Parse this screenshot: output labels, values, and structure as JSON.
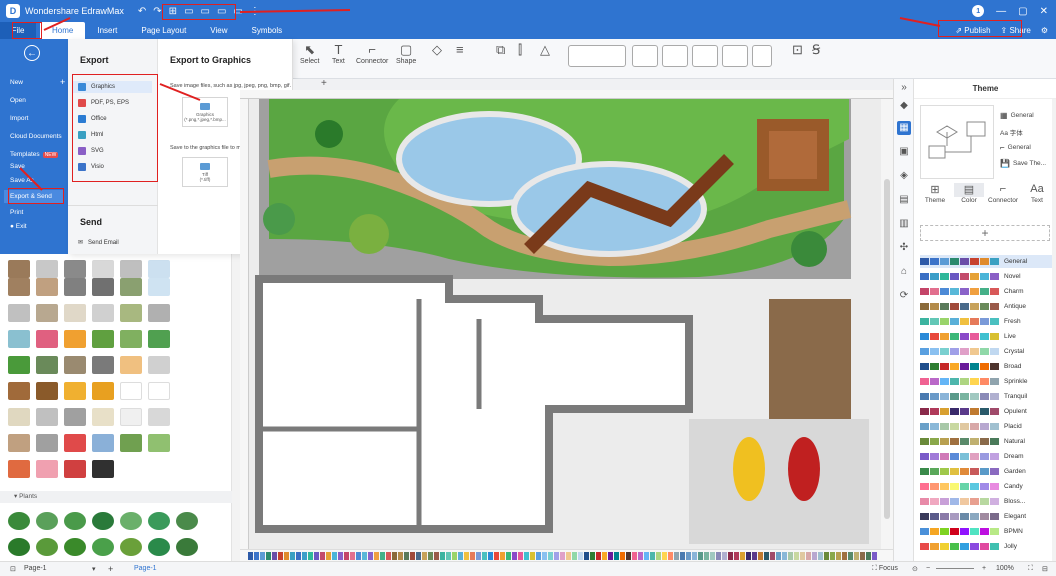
{
  "app": {
    "name": "Wondershare EdrawMax",
    "logo": "D"
  },
  "menu": {
    "file": "File",
    "home": "Home",
    "insert": "Insert",
    "page_layout": "Page Layout",
    "view": "View",
    "symbols": "Symbols"
  },
  "top_right": {
    "publish": "Publish",
    "share": "Share",
    "badge": "1"
  },
  "ribbon": {
    "select": "Select",
    "text": "Text",
    "connector": "Connector",
    "shape": "Shape"
  },
  "file_menu": {
    "items": [
      "New",
      "Open",
      "Import",
      "Cloud Documents",
      "Templates",
      "Save",
      "Save As",
      "Export & Send",
      "Print",
      "Exit"
    ],
    "new_badge": "NEW"
  },
  "export": {
    "heading": "Export",
    "heading_graphics": "Export to Graphics",
    "send_heading": "Send",
    "formats": [
      "Graphics",
      "PDF, PS, EPS",
      "Office",
      "Html",
      "SVG",
      "Visio"
    ],
    "send_email": "Send Email",
    "desc1": "Save image files, such as jpg, jpeg, png, bmp, gif.",
    "card1_label": "Graphics",
    "card1_sub": "(*.png,*.jpeg,*.bmp...",
    "desc2": "Save to the graphics file to multiple page tiff file.",
    "card2_label": "Tiff",
    "card2_sub": "(*.tiff)"
  },
  "library": {
    "plants_header": "Plants"
  },
  "tabs": {
    "page1": "Page-1",
    "add": "+"
  },
  "status": {
    "page_label": "Page-1",
    "focus": "Focus",
    "zoom": "100%"
  },
  "theme": {
    "title": "Theme",
    "options": [
      "General",
      "Aa 字体",
      "General",
      "Save The..."
    ],
    "tabs": [
      "Theme",
      "Color",
      "Connector",
      "Text"
    ],
    "add": "+",
    "palettes": [
      {
        "name": "General",
        "colors": [
          "#2d5aa8",
          "#3b73c9",
          "#5b9bd5",
          "#2b8a6e",
          "#6a4ea8",
          "#c7422e",
          "#e08b2c",
          "#3aa0c2"
        ]
      },
      {
        "name": "Novel",
        "colors": [
          "#3a6fc4",
          "#3b9ec9",
          "#2fb89a",
          "#6a58c2",
          "#c34b6b",
          "#e6a135",
          "#4bb5d8",
          "#8a5fc6"
        ]
      },
      {
        "name": "Charm",
        "colors": [
          "#c44468",
          "#e26f8e",
          "#4d8ad6",
          "#58b8d8",
          "#8a63c9",
          "#f0a040",
          "#45b088",
          "#d85858"
        ]
      },
      {
        "name": "Antique",
        "colors": [
          "#8a6a3a",
          "#b38b4a",
          "#5a7a5a",
          "#a04a3a",
          "#4a6a8a",
          "#c7a25a",
          "#6a8a5a",
          "#9a5a4a"
        ]
      },
      {
        "name": "Fresh",
        "colors": [
          "#3cb4a0",
          "#62c7b6",
          "#9ad46a",
          "#5ab0d8",
          "#f0c040",
          "#e67a5a",
          "#7a9ad8",
          "#4ac0c0"
        ]
      },
      {
        "name": "Live",
        "colors": [
          "#2a8ad8",
          "#e8483c",
          "#f0a030",
          "#3cb878",
          "#8a4ac8",
          "#e85a9a",
          "#40c0d0",
          "#d8c030"
        ]
      },
      {
        "name": "Crystal",
        "colors": [
          "#5aa0e0",
          "#8ac0f0",
          "#7ad0d0",
          "#a0a0e8",
          "#e0a0c8",
          "#f0c890",
          "#90d8a8",
          "#c0d8f0"
        ]
      },
      {
        "name": "Broad",
        "colors": [
          "#1f4e8c",
          "#2e7d32",
          "#c62828",
          "#f9a825",
          "#6a1b9a",
          "#00838f",
          "#ef6c00",
          "#4e342e"
        ]
      },
      {
        "name": "Sprinkle",
        "colors": [
          "#f06292",
          "#ba68c8",
          "#64b5f6",
          "#4db6ac",
          "#aed581",
          "#ffd54f",
          "#ff8a65",
          "#90a4ae"
        ]
      },
      {
        "name": "Tranquil",
        "colors": [
          "#4a7ab0",
          "#6a9ac8",
          "#8ab4d8",
          "#5a9a8a",
          "#7ab4a0",
          "#a0c8c0",
          "#8a8ab8",
          "#b0b0d0"
        ]
      },
      {
        "name": "Opulent",
        "colors": [
          "#8a2a4a",
          "#b03a5a",
          "#d8a030",
          "#3a2a6a",
          "#5a3a8a",
          "#c07a30",
          "#2a5a6a",
          "#a04a6a"
        ]
      },
      {
        "name": "Placid",
        "colors": [
          "#6aa0c8",
          "#8ab8d8",
          "#a8c8a8",
          "#c8d8a0",
          "#e0c8a0",
          "#d8a8a8",
          "#b8a8d0",
          "#a0c0d0"
        ]
      },
      {
        "name": "Natural",
        "colors": [
          "#6a8a3a",
          "#8aa84a",
          "#b8a050",
          "#a07040",
          "#5a8a6a",
          "#c0b070",
          "#8a6a4a",
          "#4a7a5a"
        ]
      },
      {
        "name": "Dream",
        "colors": [
          "#7a5ac8",
          "#a07ad8",
          "#d07ab8",
          "#5a8ad8",
          "#7ac0d8",
          "#e0a0c0",
          "#9a9ae0",
          "#c0a0e0"
        ]
      },
      {
        "name": "Garden",
        "colors": [
          "#3a8a4a",
          "#5aa85a",
          "#a0c84a",
          "#e0c040",
          "#e08a3a",
          "#c85a5a",
          "#5a9ac8",
          "#8a6ac0"
        ]
      },
      {
        "name": "Candy",
        "colors": [
          "#ff6f91",
          "#ff9671",
          "#ffc75f",
          "#f9f871",
          "#67d4a8",
          "#5ac8e0",
          "#a08ae8",
          "#e88ae0"
        ]
      },
      {
        "name": "Bloss...",
        "colors": [
          "#e88aa8",
          "#f0a8c0",
          "#c8a0d8",
          "#a0b8e8",
          "#f0c8a0",
          "#e8a090",
          "#b8d8a0",
          "#d0b0e0"
        ]
      },
      {
        "name": "Elegant",
        "colors": [
          "#3a3a5a",
          "#5a5a8a",
          "#8a7aa8",
          "#a89ac0",
          "#6a8aa8",
          "#8aa8c0",
          "#a08aa0",
          "#7a6a8a"
        ]
      },
      {
        "name": "BPMN",
        "colors": [
          "#4a90d9",
          "#f5a623",
          "#7ed321",
          "#d0021b",
          "#9013fe",
          "#50e3c2",
          "#bd10e0",
          "#b8e986"
        ]
      },
      {
        "name": "Jolly",
        "colors": [
          "#e84a4a",
          "#f0a030",
          "#f0d030",
          "#4ac04a",
          "#30a0e0",
          "#8a4ae0",
          "#e04aa0",
          "#40c0b0"
        ]
      }
    ]
  },
  "colors": {
    "accent": "#2f74d0",
    "annotation": "#e02020"
  }
}
